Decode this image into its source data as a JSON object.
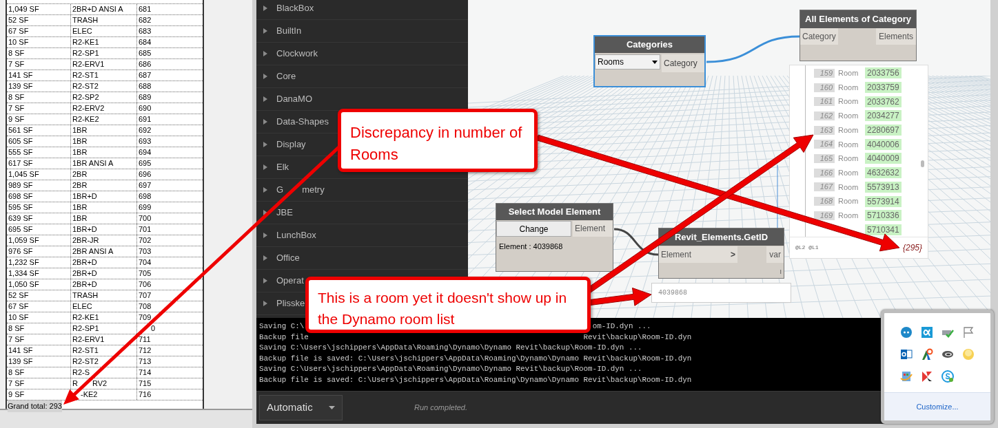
{
  "schedule": {
    "rows": [
      {
        "area": "1,049 SF",
        "name": "2BR+D ANSI A",
        "number": "681"
      },
      {
        "area": "52 SF",
        "name": "TRASH",
        "number": "682"
      },
      {
        "area": "67 SF",
        "name": "ELEC",
        "number": "683"
      },
      {
        "area": "10 SF",
        "name": "R2-KE1",
        "number": "684"
      },
      {
        "area": "8 SF",
        "name": "R2-SP1",
        "number": "685"
      },
      {
        "area": "7 SF",
        "name": "R2-ERV1",
        "number": "686"
      },
      {
        "area": "141 SF",
        "name": "R2-ST1",
        "number": "687"
      },
      {
        "area": "139 SF",
        "name": "R2-ST2",
        "number": "688"
      },
      {
        "area": "8 SF",
        "name": "R2-SP2",
        "number": "689"
      },
      {
        "area": "7 SF",
        "name": "R2-ERV2",
        "number": "690"
      },
      {
        "area": "9 SF",
        "name": "R2-KE2",
        "number": "691"
      },
      {
        "area": "561 SF",
        "name": "1BR",
        "number": "692"
      },
      {
        "area": "605 SF",
        "name": "1BR",
        "number": "693"
      },
      {
        "area": "555 SF",
        "name": "1BR",
        "number": "694"
      },
      {
        "area": "617 SF",
        "name": "1BR ANSI A",
        "number": "695"
      },
      {
        "area": "1,045 SF",
        "name": "2BR",
        "number": "696"
      },
      {
        "area": "989 SF",
        "name": "2BR",
        "number": "697"
      },
      {
        "area": "698 SF",
        "name": "1BR+D",
        "number": "698"
      },
      {
        "area": "595 SF",
        "name": "1BR",
        "number": "699"
      },
      {
        "area": "639 SF",
        "name": "1BR",
        "number": "700"
      },
      {
        "area": "695 SF",
        "name": "1BR+D",
        "number": "701"
      },
      {
        "area": "1,059 SF",
        "name": "2BR-JR",
        "number": "702"
      },
      {
        "area": "976 SF",
        "name": "2BR ANSI A",
        "number": "703"
      },
      {
        "area": "1,232 SF",
        "name": "2BR+D",
        "number": "704"
      },
      {
        "area": "1,334 SF",
        "name": "2BR+D",
        "number": "705"
      },
      {
        "area": "1,050 SF",
        "name": "2BR+D",
        "number": "706"
      },
      {
        "area": "52 SF",
        "name": "TRASH",
        "number": "707"
      },
      {
        "area": "67 SF",
        "name": "ELEC",
        "number": "708"
      },
      {
        "area": "10 SF",
        "name": "R2-KE1",
        "number": "709"
      },
      {
        "area": "8 SF",
        "name": "R2-SP1",
        "number": [
          "0"
        ]
      },
      {
        "area": "7 SF",
        "name": "R2-ERV1",
        "number": "711"
      },
      {
        "area": "141 SF",
        "name": "R2-ST1",
        "number": "712"
      },
      {
        "area": "139 SF",
        "name": "R2-ST2",
        "number": "713"
      },
      {
        "area": "8 SF",
        "name": [
          "R2-S"
        ],
        "number": "714"
      },
      {
        "area": "7 SF",
        "name": [
          "R",
          "RV2"
        ],
        "number": "715"
      },
      {
        "area": "9 SF",
        "name": [
          "-KE2"
        ],
        "number": "716"
      }
    ],
    "footer": "Grand total: 293"
  },
  "library": {
    "items": [
      "BlackBox",
      "BuiltIn",
      "Clockwork",
      "Core",
      "DanaMO",
      "Data-Shapes",
      "Display",
      "Elk",
      [
        "G",
        "metry"
      ],
      "JBE",
      "LunchBox",
      "Office",
      "Operat",
      "Plisske"
    ]
  },
  "nodes": {
    "categories": {
      "title": "Categories",
      "selected": true,
      "dropdown": "Rooms",
      "output": "Category"
    },
    "all_elements": {
      "title": "All Elements of Category",
      "input": "Category",
      "output": "Elements"
    },
    "watch_list": {
      "rows": [
        {
          "index": "159",
          "type": "Room",
          "id": "2033756"
        },
        {
          "index": "160",
          "type": "Room",
          "id": "2033759"
        },
        {
          "index": "161",
          "type": "Room",
          "id": "2033762"
        },
        {
          "index": "162",
          "type": "Room",
          "id": "2034277"
        },
        {
          "index": "163",
          "type": "Room",
          "id": "2280697"
        },
        {
          "index": "164",
          "type": "Room",
          "id": "4040006"
        },
        {
          "index": "165",
          "type": "Room",
          "id": "4040009"
        },
        {
          "index": "166",
          "type": "Room",
          "id": "4632632"
        },
        {
          "index": "167",
          "type": "Room",
          "id": "5573913"
        },
        {
          "index": "168",
          "type": "Room",
          "id": "5573914"
        },
        {
          "index": "169",
          "type": "Room",
          "id": "5710336"
        },
        {
          "id": "5710341"
        }
      ],
      "levels": "@L2 @L1",
      "count": "{295}"
    },
    "select_element": {
      "title": "Select Model Element",
      "button": "Change",
      "output": "Element",
      "value": "Element : 4039868"
    },
    "get_id": {
      "title": "Revit_Elements.GetID",
      "input": "Element",
      "input_arrow": ">",
      "output": "var",
      "lacing": "I",
      "watch": "4039868"
    }
  },
  "console": {
    "lines": [
      {
        "left": "Saving C:\\",
        "right": "om-ID.dyn ..."
      },
      {
        "left": "Backup file",
        "right": "Revit\\backup\\Room-ID.dyn"
      },
      {
        "left": "Saving C:\\Users\\jschippers\\AppData\\Roaming\\Dynamo\\Dynamo Revit\\backup\\Room-ID.dyn ..."
      },
      {
        "left": "Backup file is saved: C:\\Users\\jschippers\\AppData\\Roaming\\Dynamo\\Dynamo Revit\\backup\\Room-ID.dyn"
      },
      {
        "left": "Saving C:\\Users\\jschippers\\AppData\\Roaming\\Dynamo\\Dynamo Revit\\backup\\Room-ID.dyn ..."
      },
      {
        "left": "Backup file is saved: C:\\Users\\jschippers\\AppData\\Roaming\\Dynamo\\Dynamo Revit\\backup\\Room-ID.dyn"
      }
    ]
  },
  "run_bar": {
    "mode": "Automatic",
    "status": "Run completed."
  },
  "callouts": [
    {
      "text": "Discrepancy in number of Rooms"
    },
    {
      "text": "This is a room yet it doesn't show up in the Dynamo room list"
    }
  ],
  "tray": {
    "link": "Customize..."
  }
}
